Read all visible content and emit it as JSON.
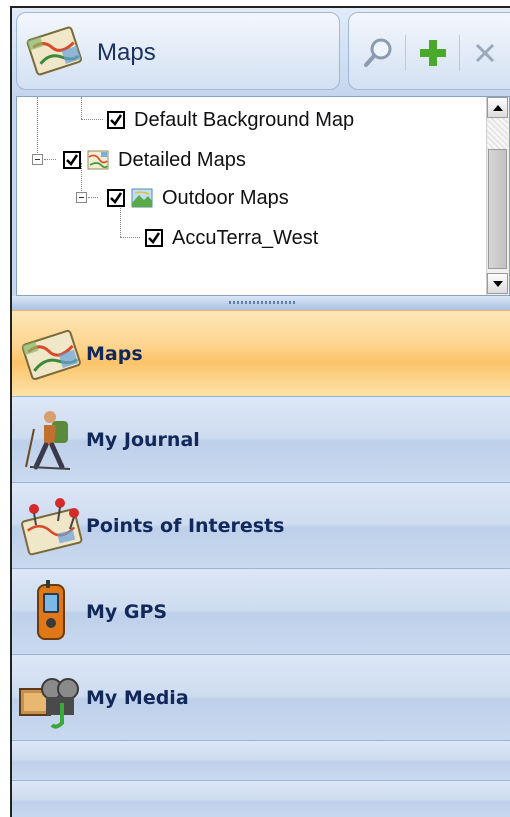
{
  "header": {
    "title": "Maps",
    "icon": "maps-icon",
    "tools": [
      {
        "icon": "search-icon"
      },
      {
        "icon": "add-icon"
      },
      {
        "icon": "close-icon"
      }
    ]
  },
  "tree": {
    "items": [
      {
        "label": "Default Background Map",
        "checked": true,
        "icon": null
      },
      {
        "label": "Detailed Maps",
        "checked": true,
        "icon": "detailed-maps-icon"
      },
      {
        "label": "Outdoor Maps",
        "checked": true,
        "icon": "outdoor-maps-icon"
      },
      {
        "label": "AccuTerra_West",
        "checked": true,
        "icon": null
      }
    ]
  },
  "nav": {
    "items": [
      {
        "label": "Maps",
        "icon": "maps-icon",
        "active": true
      },
      {
        "label": "My Journal",
        "icon": "hiker-icon",
        "active": false
      },
      {
        "label": "Points of Interests",
        "icon": "poi-map-icon",
        "active": false
      },
      {
        "label": "My GPS",
        "icon": "gps-device-icon",
        "active": false
      },
      {
        "label": "My Media",
        "icon": "media-icon",
        "active": false
      }
    ]
  },
  "colors": {
    "active_accent": "#fcc46a",
    "nav_bg": "#c6d7ee",
    "text_dark": "#12285a"
  }
}
